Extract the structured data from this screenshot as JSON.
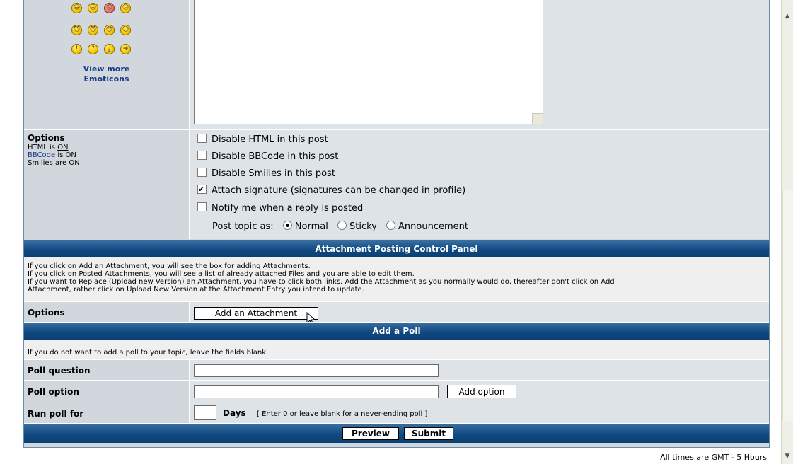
{
  "emoticons": {
    "row1": [
      "😃",
      "😛",
      "😡",
      "☹"
    ],
    "row2": [
      "😈",
      "😈",
      "😎",
      "☺"
    ],
    "row3": [
      "!",
      "?",
      "💡",
      "➜"
    ],
    "view_more_line1": "View more",
    "view_more_line2": "Emoticons"
  },
  "options_section": {
    "heading": "Options",
    "html_label": "HTML is",
    "html_value": "ON",
    "bbcode_link": "BBCode",
    "bbcode_label": "is",
    "bbcode_value": "ON",
    "smilies_label": "Smilies are",
    "smilies_value": "ON",
    "checkboxes": [
      {
        "label": "Disable HTML in this post",
        "checked": false
      },
      {
        "label": "Disable BBCode in this post",
        "checked": false
      },
      {
        "label": "Disable Smilies in this post",
        "checked": false
      },
      {
        "label": "Attach signature (signatures can be changed in profile)",
        "checked": true
      },
      {
        "label": "Notify me when a reply is posted",
        "checked": false
      }
    ],
    "post_topic_label": "Post topic as:",
    "post_topic_options": [
      "Normal",
      "Sticky",
      "Announcement"
    ],
    "post_topic_selected": "Normal"
  },
  "attachment_panel": {
    "title": "Attachment Posting Control Panel",
    "help_lines": [
      "If you click on Add an Attachment, you will see the box for adding Attachments.",
      "If you click on Posted Attachments, you will see a list of already attached Files and you are able to edit them.",
      "If you want to Replace (Upload new Version) an Attachment, you have to click both links. Add the Attachment as you normally would do, thereafter don't click on Add",
      "Attachment, rather click on Upload New Version at the Attachment Entry you intend to update."
    ],
    "options_label": "Options",
    "add_button": "Add an Attachment"
  },
  "poll": {
    "title": "Add a Poll",
    "help": "If you do not want to add a poll to your topic, leave the fields blank.",
    "question_label": "Poll question",
    "question_value": "",
    "option_label": "Poll option",
    "option_value": "",
    "add_option_button": "Add option",
    "run_label": "Run poll for",
    "run_value": "",
    "days_label": "Days",
    "run_hint": "[ Enter 0 or leave blank for a never-ending poll ]"
  },
  "actions": {
    "preview": "Preview",
    "submit": "Submit"
  },
  "footer": {
    "timezone": "All times are GMT - 5 Hours"
  },
  "colors": {
    "header_blue": "#0f4a82",
    "row_light": "#dee3e7",
    "row_mid": "#d1d7dc",
    "link": "#1a3c88"
  }
}
